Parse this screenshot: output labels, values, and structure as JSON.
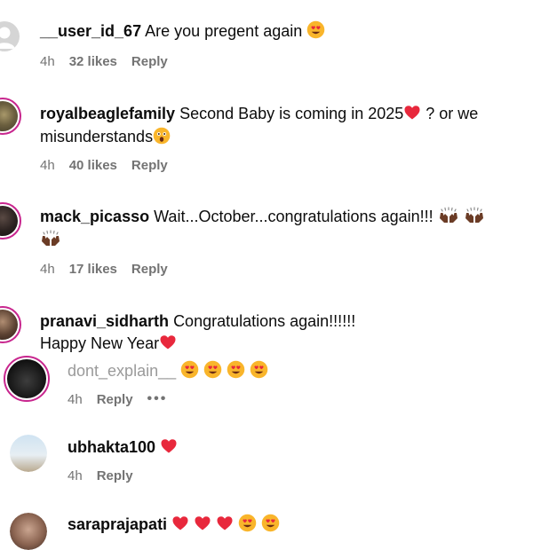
{
  "comments": [
    {
      "user": "__user_id_67",
      "text": "Are you pregent again",
      "time": "4h",
      "likes": "32 likes",
      "reply": "Reply"
    },
    {
      "user": "royalbeaglefamily",
      "text": "Second Baby is coming in 2025",
      "text_after": "? or we",
      "text2": "misunderstands",
      "time": "4h",
      "likes": "40 likes",
      "reply": "Reply"
    },
    {
      "user": "mack_picasso",
      "text": "Wait...October...congratulations again!!!",
      "time": "4h",
      "likes": "17 likes",
      "reply": "Reply"
    },
    {
      "user": "pranavi_sidharth",
      "text": "Congratulations again!!!!!!",
      "text2": "Happy New Year"
    },
    {
      "user": "dont_explain__",
      "time": "4h",
      "reply": "Reply",
      "more": "•••"
    },
    {
      "user": "ubhakta100",
      "time": "4h",
      "reply": "Reply"
    },
    {
      "user": "saraprajapati"
    }
  ],
  "icons": [
    "heart-eyes-emoji",
    "red-heart-emoji",
    "astonished-emoji",
    "raised-hands-emoji",
    "more-options-icon"
  ],
  "colors": {
    "story_ring": "#c8268e",
    "meta_text": "#737373",
    "text": "#0c0c0c",
    "heart": "#e8283c"
  }
}
